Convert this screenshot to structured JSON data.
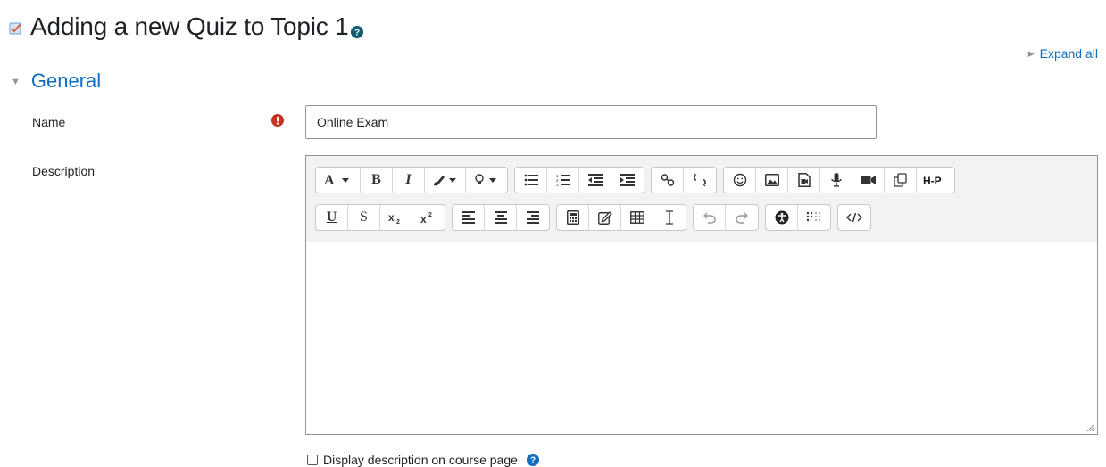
{
  "page": {
    "title": "Adding a new Quiz to Topic 1",
    "quiz_icon": "quiz-icon",
    "help_icon": "question-circle-icon"
  },
  "expand_all": {
    "label": "Expand all"
  },
  "section": {
    "title": "General",
    "collapsed": false
  },
  "form": {
    "name_label": "Name",
    "name_value": "Online Exam",
    "name_required": true,
    "description_label": "Description",
    "description_value": ""
  },
  "editor_toolbar": {
    "row1": [
      [
        "font-size-dropdown",
        "bold",
        "italic",
        "text-color-dropdown",
        "highlight-dropdown"
      ],
      [
        "unordered-list",
        "ordered-list",
        "outdent",
        "indent"
      ],
      [
        "link",
        "unlink"
      ],
      [
        "emoji",
        "image",
        "media",
        "record-audio",
        "record-video",
        "manage-files",
        "h5p"
      ]
    ],
    "row2": [
      [
        "underline",
        "strikethrough",
        "subscript",
        "superscript"
      ],
      [
        "align-left",
        "align-center",
        "align-right"
      ],
      [
        "equation",
        "character-map",
        "table",
        "clear-formatting"
      ],
      [
        "undo",
        "redo"
      ],
      [
        "accessibility-checker",
        "screenreader-helper"
      ],
      [
        "html-source"
      ]
    ]
  },
  "display_description": {
    "label": "Display description on course page",
    "checked": false
  },
  "colors": {
    "link": "#0f6cbf",
    "required": "#ca3120",
    "help": "#0f6cbf"
  }
}
